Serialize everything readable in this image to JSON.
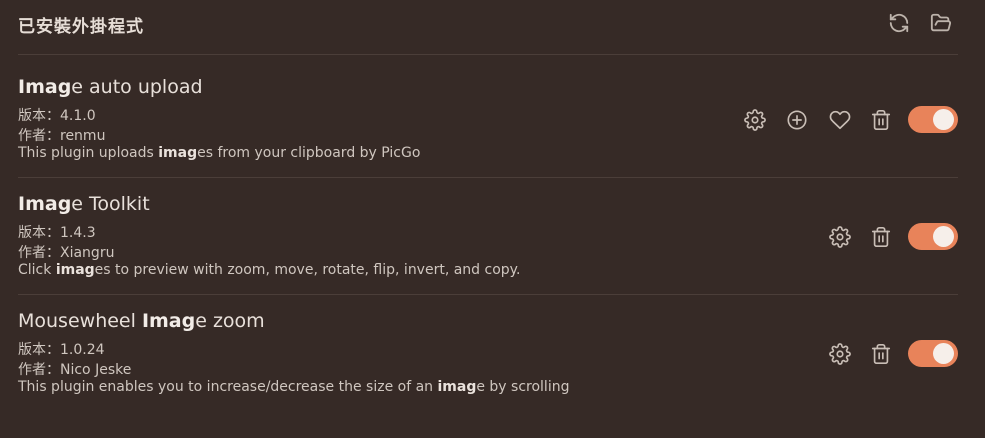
{
  "header": {
    "title": "已安裝外掛程式"
  },
  "plugins": [
    {
      "name_highlight": "Imag",
      "name_rest": "e auto upload",
      "version": "版本：4.1.0",
      "author": "作者：renmu",
      "desc_pre": "This plugin uploads ",
      "desc_highlight": "imag",
      "desc_post": "es from your clipboard by PicGo",
      "enabled": true
    },
    {
      "name_highlight": "Imag",
      "name_rest": "e Toolkit",
      "version": "版本：1.4.3",
      "author": "作者：Xiangru",
      "desc_pre": "Click ",
      "desc_highlight": "imag",
      "desc_post": "es to preview with zoom, move, rotate, flip, invert, and copy.",
      "enabled": true
    },
    {
      "name_pre": "Mousewheel ",
      "name_highlight": "Imag",
      "name_rest": "e zoom",
      "version": "版本：1.0.24",
      "author": "作者：Nico Jeske",
      "desc_pre": "This plugin enables you to increase/decrease the size of an ",
      "desc_highlight": "imag",
      "desc_post": "e by scrolling",
      "enabled": true
    }
  ],
  "colors": {
    "background": "#362a26",
    "toggle_on": "#e8835a",
    "divider": "#4b3e39"
  },
  "icons": {
    "header": [
      "reload-icon",
      "folder-open-icon"
    ],
    "plugin_actions": [
      "gear-icon",
      "plus-circle-icon",
      "heart-icon",
      "trash-icon"
    ]
  }
}
